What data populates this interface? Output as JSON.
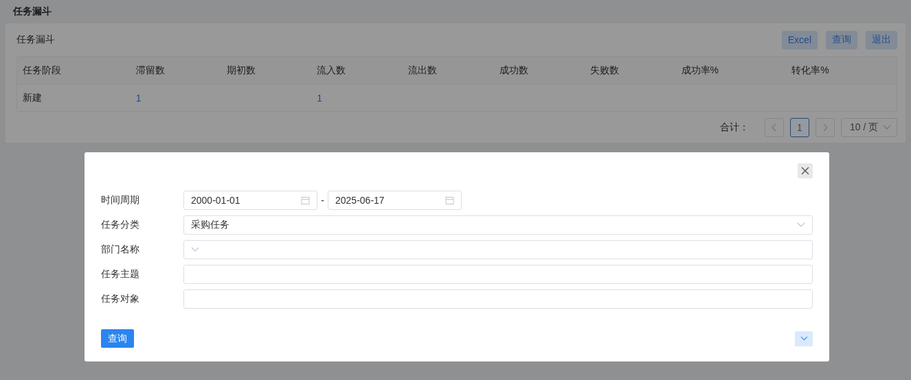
{
  "page_title": "任务漏斗",
  "card": {
    "title": "任务漏斗",
    "buttons": [
      "Excel",
      "查询",
      "退出"
    ]
  },
  "table": {
    "columns": [
      "任务阶段",
      "滞留数",
      "期初数",
      "流入数",
      "流出数",
      "成功数",
      "失败数",
      "成功率%",
      "转化率%"
    ],
    "rows": [
      {
        "cells": [
          {
            "text": "新建",
            "kind": "text"
          },
          {
            "text": "1",
            "kind": "link"
          },
          null,
          {
            "text": "1",
            "kind": "link"
          },
          null,
          null,
          null,
          null,
          null
        ]
      }
    ]
  },
  "pagination": {
    "total_label": "合计：",
    "pages": [
      {
        "label": "1",
        "selected": true
      }
    ],
    "page_size": "10 / 页"
  },
  "dialog": {
    "fields": [
      {
        "label": "时间周期",
        "kind": "date_range",
        "from": "2000-01-01",
        "to": "2025-06-17",
        "separator": "-"
      },
      {
        "label": "任务分类",
        "kind": "select",
        "value": "采购任务"
      },
      {
        "label": "部门名称",
        "kind": "select"
      },
      {
        "label": "任务主题",
        "kind": "text"
      },
      {
        "label": "任务对象",
        "kind": "text"
      }
    ],
    "submit": "查询"
  }
}
